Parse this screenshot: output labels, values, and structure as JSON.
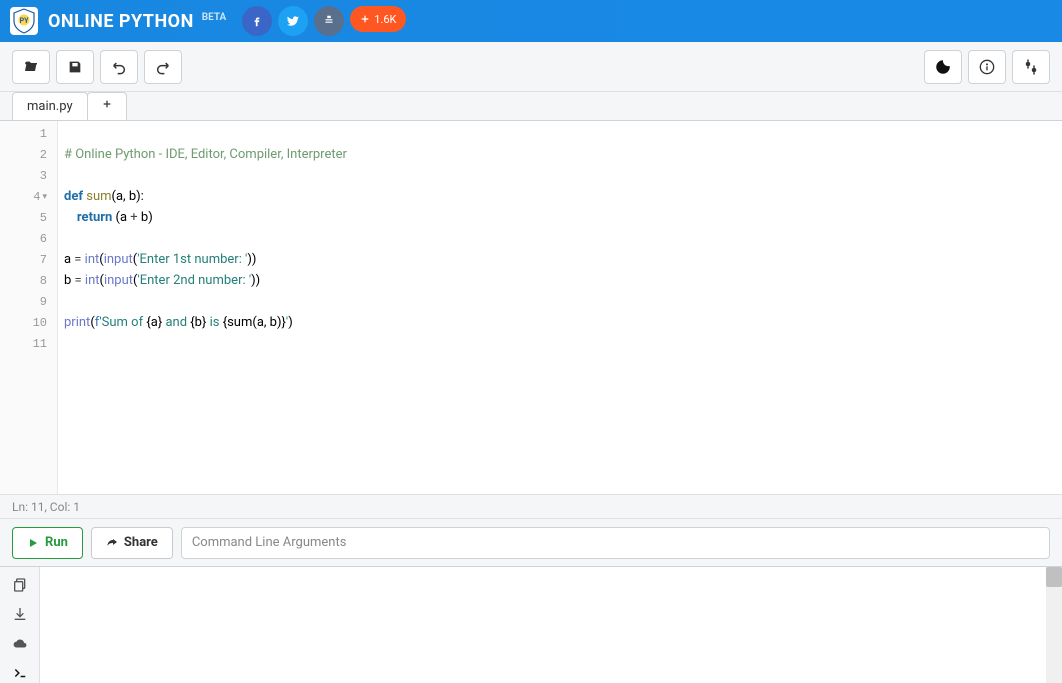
{
  "header": {
    "brand": "ONLINE PYTHON",
    "beta": "BETA",
    "share_count": "1.6K"
  },
  "toolbar": {
    "left_icons": [
      "folder-open",
      "save",
      "undo",
      "redo"
    ],
    "right_icons": [
      "dark-mode",
      "info",
      "settings"
    ]
  },
  "tabs": {
    "items": [
      {
        "label": "main.py"
      }
    ]
  },
  "editor": {
    "lines": [
      {
        "n": 1,
        "t": "",
        "fold": false
      },
      {
        "n": 2,
        "t": "# Online Python - IDE, Editor, Compiler, Interpreter",
        "fold": false,
        "cls": "comment"
      },
      {
        "n": 3,
        "t": "",
        "fold": false
      },
      {
        "n": 4,
        "t": "def sum(a, b):",
        "fold": true,
        "cls": "def"
      },
      {
        "n": 5,
        "t": "    return (a + b)",
        "fold": false,
        "cls": "ret"
      },
      {
        "n": 6,
        "t": "",
        "fold": false
      },
      {
        "n": 7,
        "t": "a = int(input('Enter 1st number: '))",
        "fold": false,
        "cls": "call"
      },
      {
        "n": 8,
        "t": "b = int(input('Enter 2nd number: '))",
        "fold": false,
        "cls": "call"
      },
      {
        "n": 9,
        "t": "",
        "fold": false
      },
      {
        "n": 10,
        "t": "print(f'Sum of {a} and {b} is {sum(a, b)}')",
        "fold": false,
        "cls": "print"
      },
      {
        "n": 11,
        "t": "",
        "fold": false
      }
    ]
  },
  "status": {
    "text": "Ln: 11,  Col: 1"
  },
  "runbar": {
    "run_label": "Run",
    "share_label": "Share",
    "cli_placeholder": "Command Line Arguments"
  },
  "console": {
    "side_icons": [
      "copy",
      "download",
      "cloud",
      "terminal"
    ]
  }
}
